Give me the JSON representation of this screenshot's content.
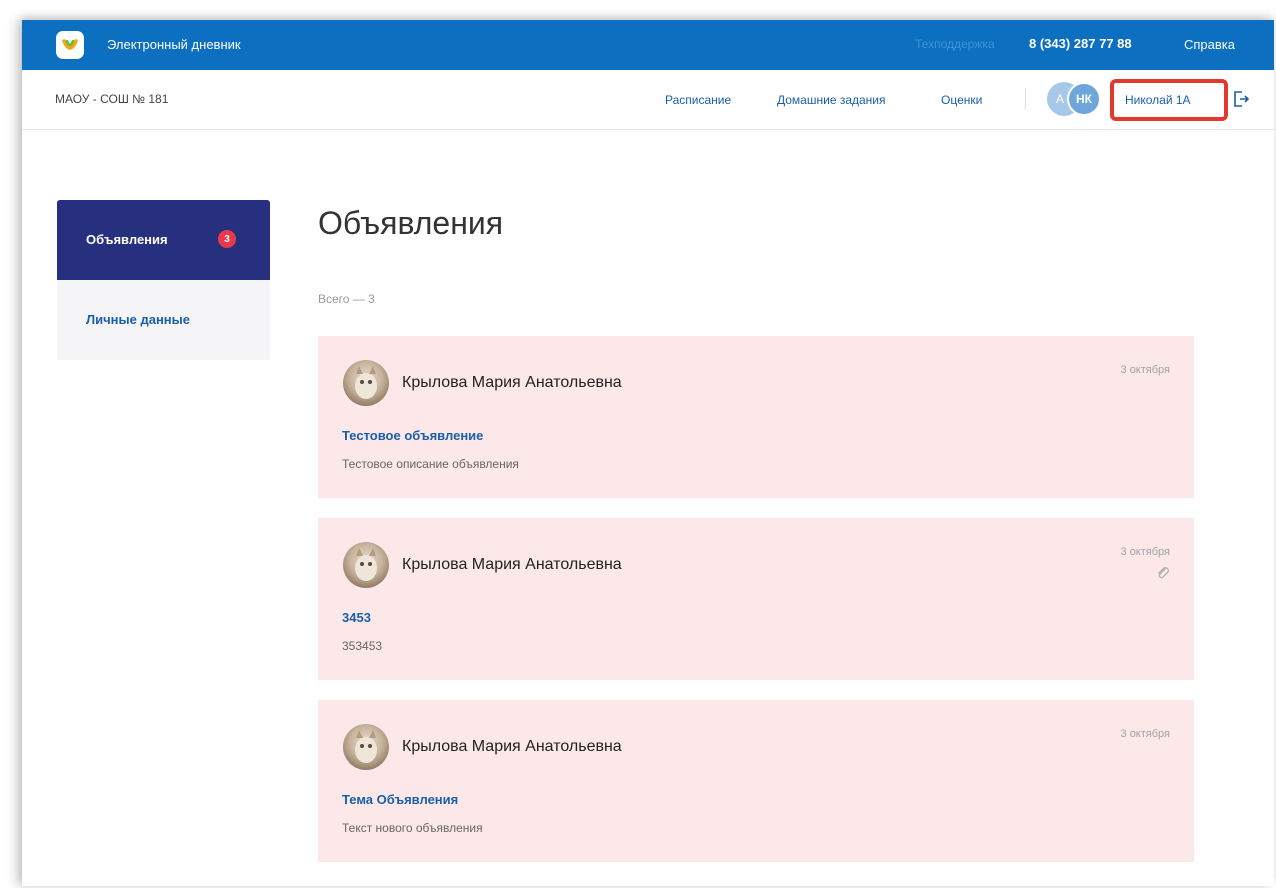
{
  "header": {
    "app_title": "Электронный дневник",
    "support_label": "Техподдержка",
    "support_phone": "8 (343) 287 77 88",
    "help_label": "Справка",
    "brand_color": "#0c6fc0"
  },
  "nav": {
    "school": "МАОУ - СОШ № 181",
    "links": [
      "Расписание",
      "Домашние задания",
      "Оценки"
    ],
    "avatar_secondary": "А",
    "avatar_primary": "НК",
    "user_name": "Николай 1А"
  },
  "sidebar": {
    "items": [
      {
        "label": "Объявления",
        "badge": "3",
        "active": true
      },
      {
        "label": "Личные данные",
        "active": false
      }
    ],
    "active_color": "#26307f"
  },
  "main": {
    "title": "Объявления",
    "total": "Всего — 3",
    "announcements": [
      {
        "author": "Крылова Мария Анатольевна",
        "date": "3 октября",
        "title": "Тестовое объявление",
        "text": "Тестовое описание объявления",
        "attachment": false
      },
      {
        "author": "Крылова Мария Анатольевна",
        "date": "3 октября",
        "title": "3453",
        "text": "353453",
        "attachment": true
      },
      {
        "author": "Крылова Мария Анатольевна",
        "date": "3 октября",
        "title": "Тема Объявления",
        "text": "Текст нового объявления",
        "attachment": false
      }
    ],
    "card_color": "#fce8e9"
  }
}
